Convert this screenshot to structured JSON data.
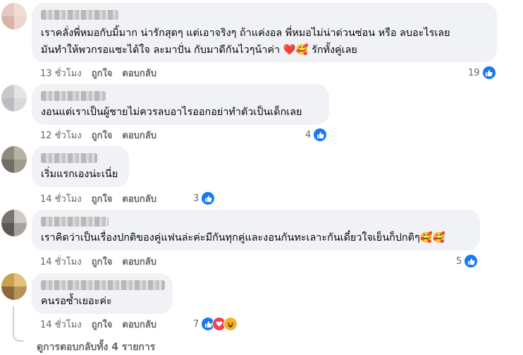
{
  "comments": [
    {
      "text_lines": [
        "เราคลั่งพี่หมอกับมิ้มาก น่ารักสุดๆ แต่เอาจริงๆ ถ้าแค่งอล พี่หมอไม่น่าด่วนซ่อน หรือ ลบอะไรเลย",
        "มันทำให้พวกรอแซะได้ใจ ละมาปั่น กับมาดีกันไวๆน้าค่า"
      ],
      "inline_emoji": [
        "❤️",
        "🥰"
      ],
      "tail_text": "รักทั้งคู่เลย",
      "time": "13 ชั่วโมง",
      "reaction_count": "19",
      "reactions": [
        "like"
      ]
    },
    {
      "text_lines": [
        "งอนแต่เราเป็นผู้ชายไม่ควรลบอาไรออกอย่าทำตัวเป็นเด็กเลย"
      ],
      "time": "12 ชั่วโมง",
      "reaction_count": "4",
      "reactions": [
        "like"
      ]
    },
    {
      "text_lines": [
        "เริ่มแรกเองน่ะเนี่ย"
      ],
      "time": "14 ชั่วโมง",
      "reaction_count": "3",
      "reactions": [
        "like"
      ]
    },
    {
      "text_lines": [
        "เราคิดว่าเป็นเรื่องปกติของคู่แฟนล่ะค่ะมีกันทุกคู่และงอนกันทะเลาะกันเดี๋ยวใจเย็นก็ปกติๆ"
      ],
      "inline_emoji": [
        "🥰",
        "🥰"
      ],
      "time": "14 ชั่วโมง",
      "reaction_count": "5",
      "reactions": [
        "like"
      ]
    },
    {
      "text_lines": [
        "คนรอซ้ำเยอะค่ะ"
      ],
      "time": "14 ชั่วโมง",
      "reaction_count": "7",
      "reactions": [
        "like",
        "love",
        "haha"
      ]
    }
  ],
  "actions": {
    "like": "ถูกใจ",
    "reply": "ตอบกลับ"
  },
  "view_replies": "ดูการตอบกลับทั้ง 4 รายการ",
  "icons": {
    "like": "thumbs-up-icon",
    "love": "heart-icon",
    "haha": "laughing-face-icon"
  },
  "colors": {
    "bubble": "#f0f2f5",
    "like_blue": "#1877f2",
    "love_red": "#f33e58",
    "haha_yellow": "#f7b125",
    "meta_gray": "#65676b"
  }
}
